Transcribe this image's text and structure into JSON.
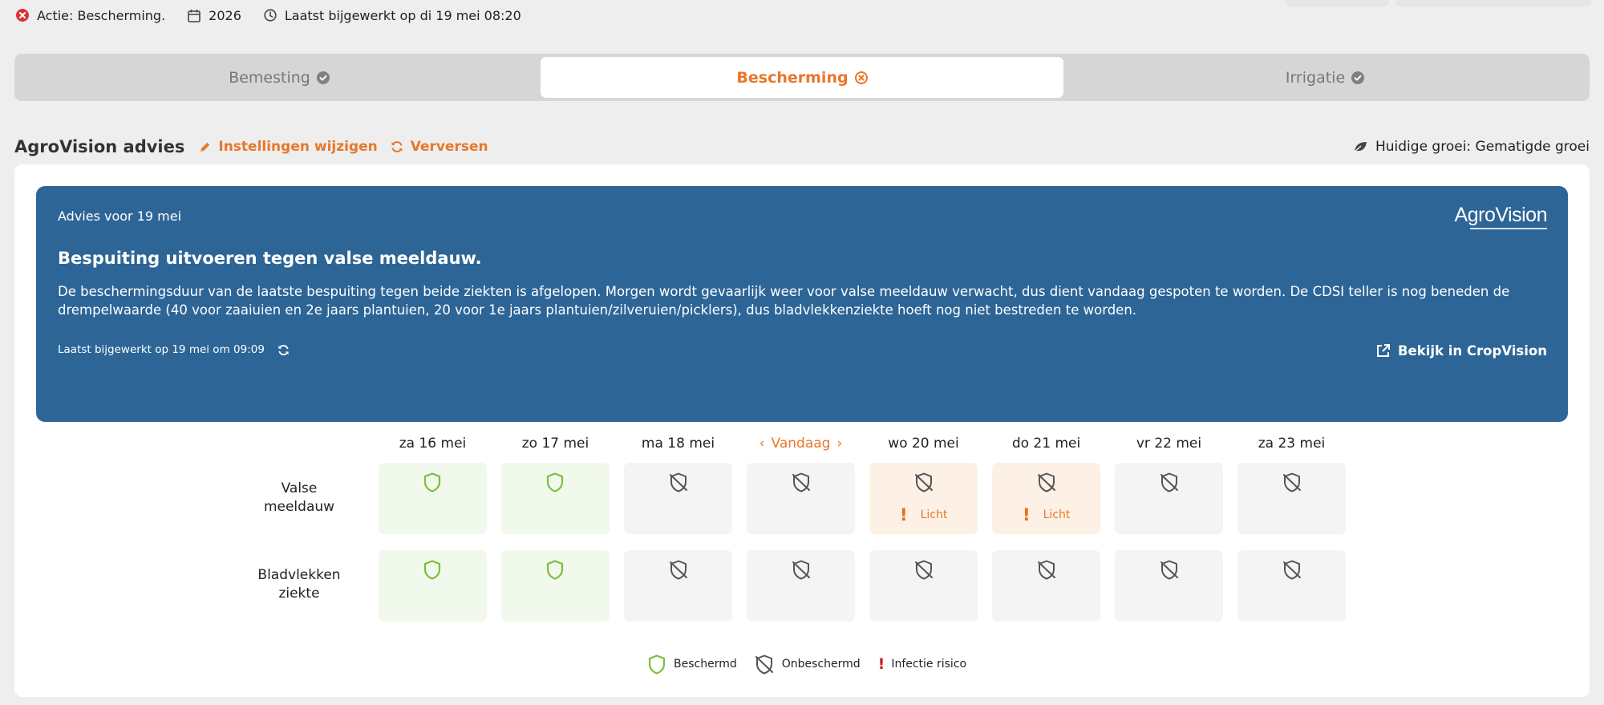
{
  "topbar": {
    "action_text": "Actie: Bescherming.",
    "year": "2026",
    "last_updated": "Laatst bijgewerkt op di 19 mei 08:20"
  },
  "tabs": [
    {
      "label": "Bemesting",
      "status": "check"
    },
    {
      "label": "Bescherming",
      "status": "error",
      "active": true
    },
    {
      "label": "Irrigatie",
      "status": "check"
    }
  ],
  "header": {
    "title": "AgroVision advies",
    "edit_settings": "Instellingen wijzigen",
    "refresh": "Verversen",
    "growth": "Huidige groei: Gematigde groei"
  },
  "advice": {
    "date": "Advies voor 19 mei",
    "logo": "AgroVision",
    "title": "Bespuiting uitvoeren tegen valse meeldauw.",
    "body": "De beschermingsduur van de laatste bespuiting tegen beide ziekten is afgelopen. Morgen wordt gevaarlijk weer voor valse meeldauw verwacht, dus dient vandaag gespoten te worden. De CDSI teller is nog beneden de drempelwaarde (40 voor zaaiuien en 2e jaars plantuien, 20 voor 1e jaars plantuien/zilveruien/picklers), dus bladvlekkenziekte hoeft nog niet bestreden te worden.",
    "updated": "Laatst bijgewerkt op 19 mei om 09:09",
    "link": "Bekijk in CropVision"
  },
  "days": [
    "za 16 mei",
    "zo 17 mei",
    "ma 18 mei",
    "Vandaag",
    "wo 20 mei",
    "do 21 mei",
    "vr 22 mei",
    "za 23 mei"
  ],
  "rows": [
    {
      "label_line1": "Valse",
      "label_line2": "meeldauw",
      "cells": [
        {
          "state": "protected"
        },
        {
          "state": "protected"
        },
        {
          "state": "unprotected"
        },
        {
          "state": "unprotected"
        },
        {
          "state": "risk",
          "risk": "Licht"
        },
        {
          "state": "risk",
          "risk": "Licht"
        },
        {
          "state": "unprotected"
        },
        {
          "state": "unprotected"
        }
      ]
    },
    {
      "label_line1": "Bladvlekken",
      "label_line2": "ziekte",
      "cells": [
        {
          "state": "protected"
        },
        {
          "state": "protected"
        },
        {
          "state": "unprotected"
        },
        {
          "state": "unprotected"
        },
        {
          "state": "unprotected"
        },
        {
          "state": "unprotected"
        },
        {
          "state": "unprotected"
        },
        {
          "state": "unprotected"
        }
      ]
    }
  ],
  "legend": {
    "protected": "Beschermd",
    "unprotected": "Onbeschermd",
    "risk": "Infectie risico"
  },
  "colors": {
    "accent": "#e8772a",
    "advice_bg": "#2d6596",
    "protected_green": "#7bbf3a",
    "error_red": "#d9323a"
  }
}
